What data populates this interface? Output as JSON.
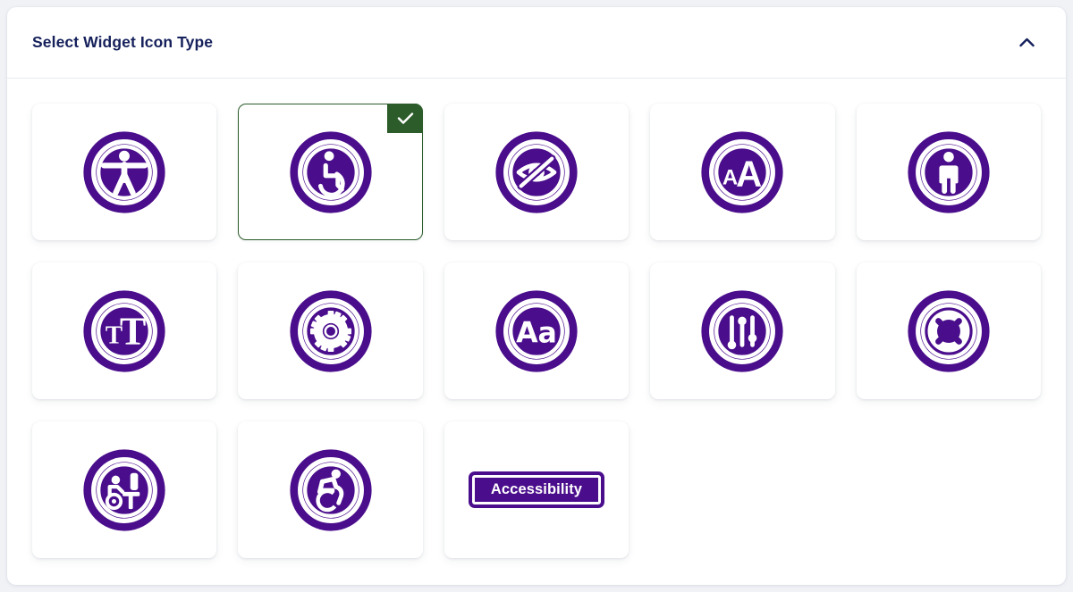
{
  "panel": {
    "title": "Select Widget Icon Type",
    "collapse_icon": "chevron-up-icon",
    "collapsed": false
  },
  "colors": {
    "icon_purple": "#4a0d8c",
    "selected_green": "#2c5c2a",
    "title_navy": "#16215c",
    "page_background": "#f0f2f6",
    "card_background": "#ffffff"
  },
  "selection": {
    "selected_index": 1,
    "badge_icon": "check-icon"
  },
  "icons": [
    {
      "id": "accessibility-person",
      "icon": "accessibility-person-icon",
      "selected": false
    },
    {
      "id": "wheelchair",
      "icon": "wheelchair-icon",
      "selected": true
    },
    {
      "id": "eye-off",
      "icon": "eye-off-icon",
      "selected": false
    },
    {
      "id": "text-resize-aa",
      "icon": "text-resize-a-icon",
      "selected": false
    },
    {
      "id": "standing-person",
      "icon": "standing-person-icon",
      "selected": false
    },
    {
      "id": "text-size-tt",
      "icon": "text-size-t-icon",
      "selected": false
    },
    {
      "id": "settings-gear",
      "icon": "gear-icon",
      "selected": false
    },
    {
      "id": "font-aa",
      "icon": "font-aa-icon",
      "selected": false
    },
    {
      "id": "sliders",
      "icon": "sliders-icon",
      "selected": false
    },
    {
      "id": "life-ring",
      "icon": "life-ring-icon",
      "selected": false
    },
    {
      "id": "wheelchair-desk",
      "icon": "wheelchair-desk-icon",
      "selected": false
    },
    {
      "id": "accessible-dynamic",
      "icon": "accessible-dynamic-icon",
      "selected": false
    },
    {
      "id": "accessibility-label",
      "icon": "accessibility-label-icon",
      "selected": false,
      "label": "Accessibility"
    }
  ]
}
